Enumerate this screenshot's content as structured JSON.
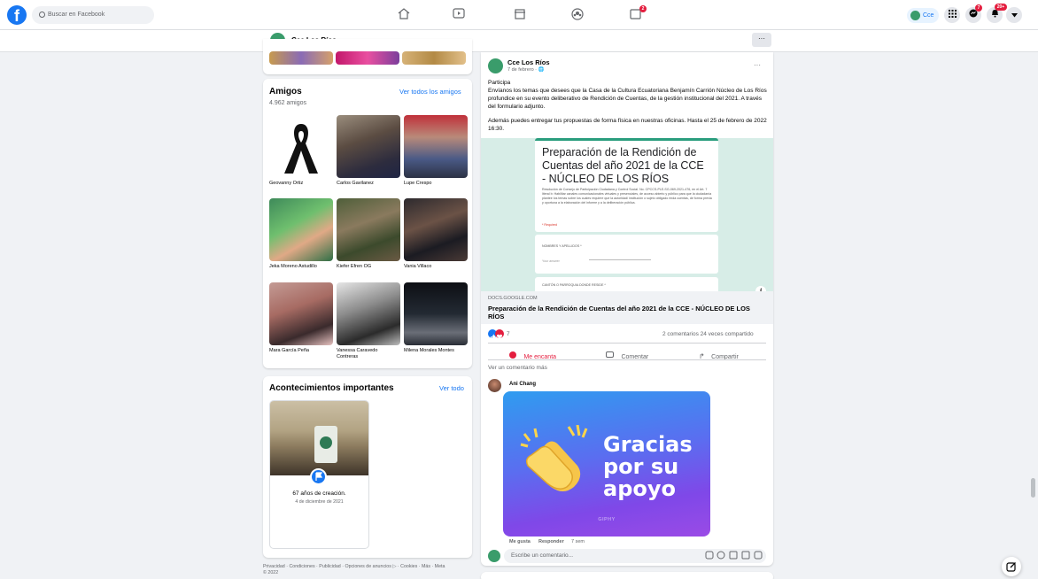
{
  "topnav": {
    "search_placeholder": "Buscar en Facebook",
    "watch_badge": "",
    "gaming_badge": "2",
    "profile_short": "Cce",
    "messenger_badge": "7",
    "notifications_badge": "20+"
  },
  "page_header": {
    "title": "Cce Los Ríos",
    "more": "···"
  },
  "friends": {
    "title": "Amigos",
    "see_all": "Ver todos los amigos",
    "count": "4.962 amigos",
    "items": [
      {
        "name": "Geovanny Ortiz"
      },
      {
        "name": "Carlos Gavilanez"
      },
      {
        "name": "Lupe Crespo"
      },
      {
        "name": "Jeka Moreno Astudillo"
      },
      {
        "name": "Kiefer Efren OG"
      },
      {
        "name": "Vania Villaco"
      },
      {
        "name": "Mara García Peña"
      },
      {
        "name": "Vanessa Caravedo Contreras"
      },
      {
        "name": "Milena Morales Montes"
      }
    ]
  },
  "events": {
    "title": "Acontecimientos importantes",
    "see_all": "Ver todo",
    "event_title": "67 años de creación.",
    "event_date": "4 de diciembre de 2021"
  },
  "footer": {
    "links": "Privacidad · Condiciones · Publicidad · Opciones de anuncios ▷ · Cookies · Más · Meta",
    "year": "© 2022"
  },
  "post": {
    "author": "Cce Los Ríos",
    "meta": "7 de febrero · 🌐",
    "more": "···",
    "p1": "Participa",
    "p2": "Envíanos los temas que desees que la Casa de la Cultura Ecuatoriana Benjamín Carrión Núcleo de Los Ríos profundice en su evento deliberativo de Rendición de Cuentas, de la gestión institucional del 2021. A través del formulario adjunto.",
    "p3": "Además puedes entregar tus propuestas de forma física en nuestras oficinas. Hasta el 25 de febrero de 2022 16:30.",
    "form": {
      "title": "Preparación de la Rendición de Cuentas del año 2021 de la CCE - NÚCLEO DE LOS RÍOS",
      "desc": "Resolución de Consejo de Participación Ciudadana y Control Social. No. CPCCS-PLE-SG-069-2021-476, en el Art. 7 literal b: Habilitar canales comunicacionales virtuales y presenciales, de acceso abierto y público para que la ciudadanía plantee los temas sobre los cuales requiere que la autoridad/ institución o sujeto obligado rinda cuentas, de forma previa y oportuna a la elaboración del informe y a la deliberación pública.",
      "required": "* Required",
      "field1": "NOMBRES Y APELLIDOS *",
      "field1_placeholder": "Your answer",
      "field2": "CANTÓN O PARROQUIA DONDE RESIDE *"
    },
    "link_domain": "DOCS.GOOGLE.COM",
    "link_title": "Preparación de la Rendición de Cuentas del año 2021 de la CCE - NÚCLEO DE LOS RÍOS",
    "reactions_count": "7",
    "comments_shares": "2 comentarios  24 veces compartido",
    "love_label": "Me encanta",
    "comment_label": "Comentar",
    "share_label": "Compartir",
    "more_comments": "Ver un comentario más",
    "commenter": "Ani Chang",
    "gif_text": "Gracias por su apoyo",
    "gif_brand": "GIPHY",
    "like_action": "Me gusta",
    "reply_action": "Responder",
    "time": "7 sem",
    "write_placeholder": "Escribe un comentario..."
  },
  "colors": {
    "brand": "#1877f2",
    "badge": "#e41e3f",
    "love": "#e41e3f"
  }
}
